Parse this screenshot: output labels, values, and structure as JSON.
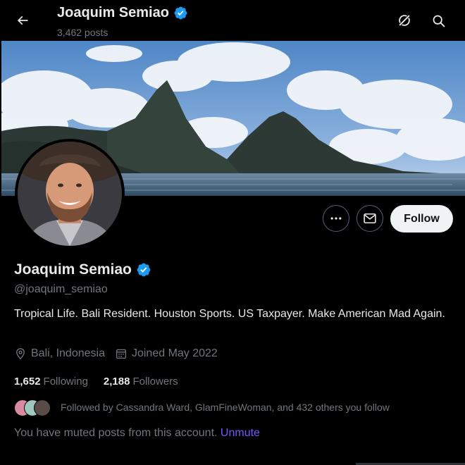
{
  "header": {
    "back_icon": "arrow-left-icon",
    "name": "Joaquim Semiao",
    "posts": "3,462 posts",
    "grok_icon": "grok-icon",
    "search_icon": "search-icon"
  },
  "profile": {
    "display_name": "Joaquim Semiao",
    "handle": "@joaquim_semiao",
    "verified_icon": "verified-badge-icon",
    "bio": "Tropical Life. Bali Resident. Houston Sports. US Taxpayer. Make American Mad Again.",
    "location": "Bali, Indonesia",
    "location_icon": "location-pin-icon",
    "joined": "Joined May 2022",
    "joined_icon": "calendar-icon"
  },
  "actions": {
    "more_icon": "more-icon",
    "message_icon": "mail-icon",
    "follow_label": "Follow"
  },
  "stats": {
    "following_count": "1,652",
    "following_label": "Following",
    "followers_count": "2,188",
    "followers_label": "Followers"
  },
  "followed_by": "Followed by Cassandra Ward, GlamFineWoman, and 432 others you follow",
  "muted": {
    "text": "You have muted posts from this account. ",
    "unmute_label": "Unmute"
  },
  "colors": {
    "background": "#000000",
    "text_primary": "#e7e9ea",
    "text_secondary": "#71767b",
    "verified_blue": "#1d9bf0",
    "unmute_purple": "#7856ff",
    "follow_bg": "#eff3f4"
  }
}
